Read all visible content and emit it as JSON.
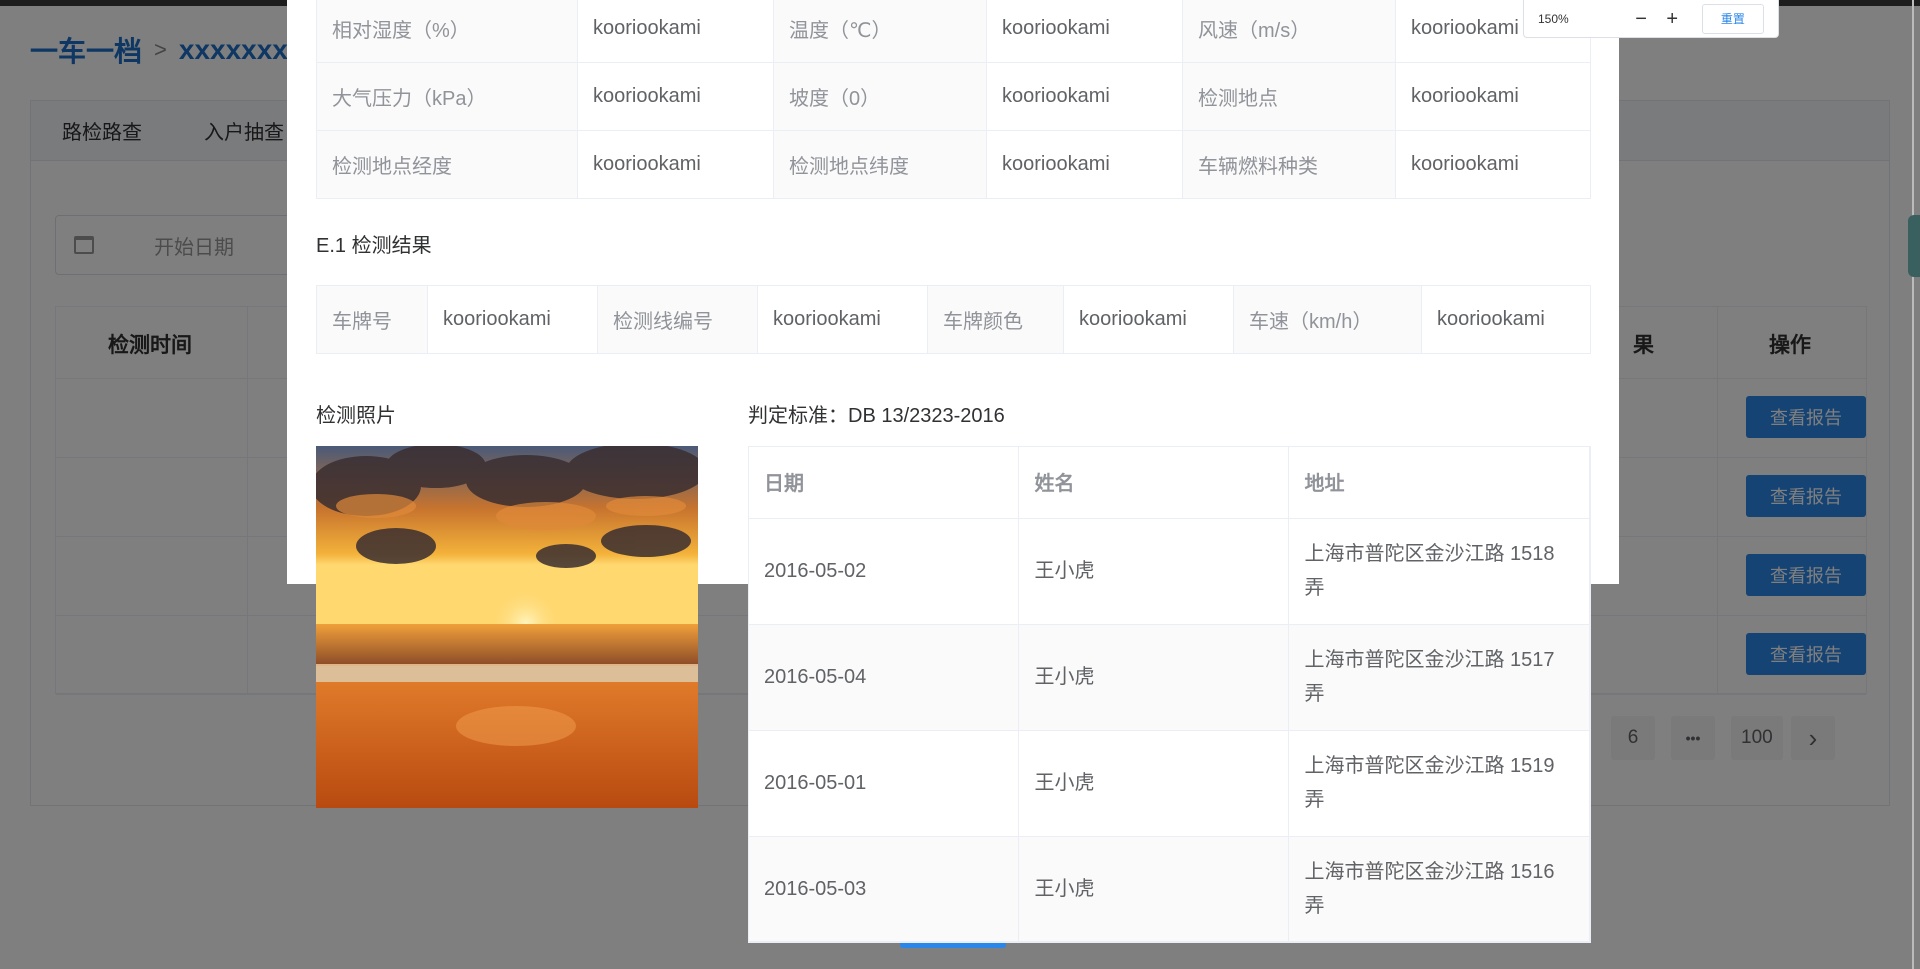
{
  "background": {
    "breadcrumb": {
      "root": "一车一档",
      "separator": ">",
      "current": "xxxxxxx"
    },
    "tabs": [
      "路检路查",
      "入户抽查"
    ],
    "date_placeholder": "开始日期",
    "table_headers": {
      "time": "检测时间",
      "result_partial": "果",
      "action": "操作"
    },
    "report_button_label": "查看报告",
    "pagination": {
      "page_6": "6",
      "ellipsis": "•••",
      "last": "100",
      "next": "›"
    }
  },
  "zoom": {
    "level": "150%",
    "minus": "−",
    "plus": "+",
    "reset": "重置"
  },
  "dialog": {
    "env_rows": [
      [
        {
          "label": "相对湿度（%）",
          "value": "kooriookami"
        },
        {
          "label": "温度（℃）",
          "value": "kooriookami"
        },
        {
          "label": "风速（m/s）",
          "value": "kooriookami"
        }
      ],
      [
        {
          "label": "大气压力（kPa）",
          "value": "kooriookami"
        },
        {
          "label": "坡度（0）",
          "value": "kooriookami"
        },
        {
          "label": "检测地点",
          "value": "kooriookami"
        }
      ],
      [
        {
          "label": "检测地点经度",
          "value": "kooriookami"
        },
        {
          "label": "检测地点纬度",
          "value": "kooriookami"
        },
        {
          "label": "车辆燃料种类",
          "value": "kooriookami"
        }
      ]
    ],
    "section_title": "E.1 检测结果",
    "result_info": [
      {
        "label": "车牌号",
        "value": "kooriookami"
      },
      {
        "label": "检测线编号",
        "value": "kooriookami"
      },
      {
        "label": "车牌颜色",
        "value": "kooriookami"
      },
      {
        "label": "车速（km/h）",
        "value": "kooriookami"
      }
    ],
    "photo_label": "检测照片",
    "standard": "判定标准：DB 13/2323-2016",
    "table": {
      "headers": [
        "日期",
        "姓名",
        "地址"
      ],
      "rows": [
        [
          "2016-05-02",
          "王小虎",
          "上海市普陀区金沙江路 1518 弄"
        ],
        [
          "2016-05-04",
          "王小虎",
          "上海市普陀区金沙江路 1517 弄"
        ],
        [
          "2016-05-01",
          "王小虎",
          "上海市普陀区金沙江路 1519 弄"
        ],
        [
          "2016-05-03",
          "王小虎",
          "上海市普陀区金沙江路 1516 弄"
        ]
      ]
    }
  }
}
